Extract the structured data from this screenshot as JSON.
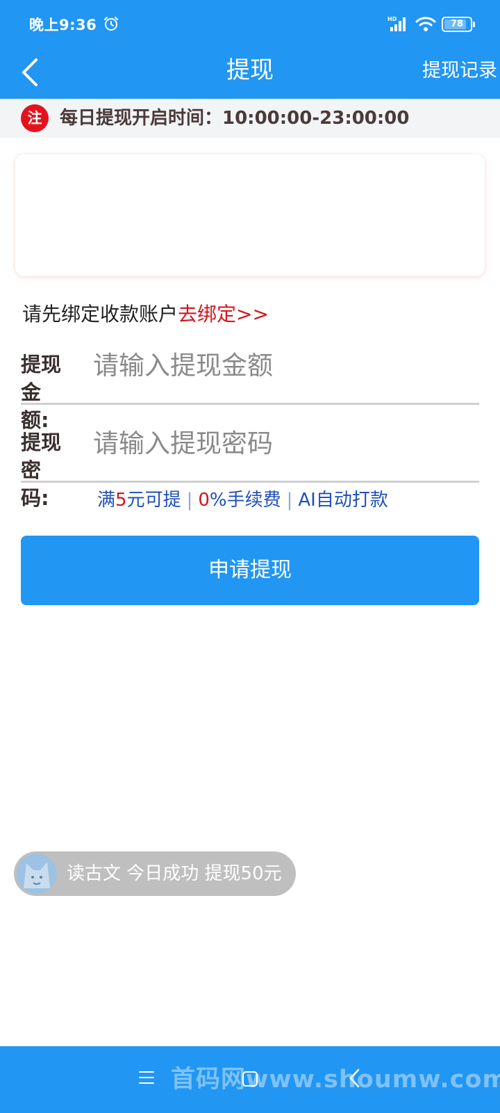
{
  "status_bar": {
    "time": "晚上9:36",
    "battery": "78",
    "battery_level": 0.78,
    "icons": [
      "alarm-icon",
      "signal-hd-icon",
      "wifi-icon",
      "battery-icon"
    ]
  },
  "nav": {
    "title": "提现",
    "record_label": "提现记录"
  },
  "notice": {
    "badge": "注",
    "text": "每日提现开启时间：10:00:00-23:00:00"
  },
  "bind": {
    "prompt": "请先绑定收款账户",
    "link": "去绑定>>"
  },
  "form": {
    "amount": {
      "label": "提现金额:",
      "placeholder": "请输入提现金额",
      "value": ""
    },
    "password": {
      "label": "提现密码:",
      "placeholder": "请输入提现密码",
      "value": ""
    }
  },
  "features": {
    "part1_a": "满",
    "part1_num": "5",
    "part1_b": "元可提",
    "part2_num": "0",
    "part2_b": "%手续费",
    "part3": "AI自动打款",
    "separator": "|"
  },
  "submit_label": "申请提现",
  "ticker": {
    "text": "读古文 今日成功 提现50元"
  },
  "bottom_nav": {
    "watermark": "首码网www.shoumw.com"
  },
  "colors": {
    "primary": "#2196f3",
    "accent_red": "#d4141c",
    "badge_red": "#e3131e",
    "feature_blue": "#1f4fb8"
  }
}
